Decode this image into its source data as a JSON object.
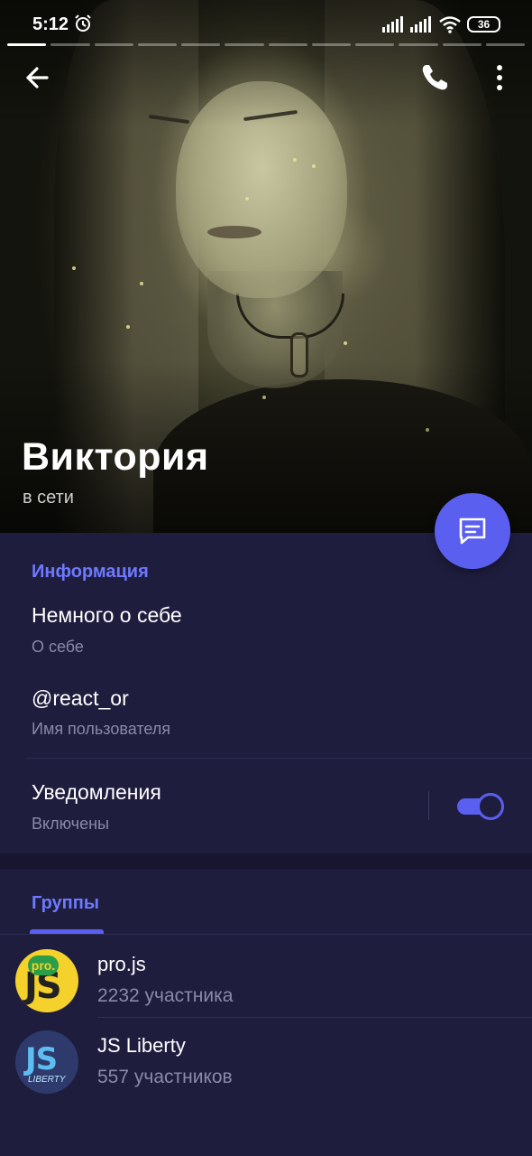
{
  "status_bar": {
    "time": "5:12",
    "battery": "36",
    "icons": [
      "alarm-icon",
      "signal-icon",
      "signal-icon",
      "wifi-icon",
      "battery-icon"
    ]
  },
  "story_progress": {
    "segments": 12,
    "active_index": 0
  },
  "header_actions": {
    "back_icon": "arrow-left-icon",
    "call_icon": "phone-icon",
    "more_icon": "more-vertical-icon"
  },
  "profile": {
    "name": "Виктория",
    "status": "в сети"
  },
  "fab": {
    "icon": "message-icon",
    "color": "#5b5ff0"
  },
  "info": {
    "section_title": "Информация",
    "bio": {
      "value": "Немного о себе",
      "label": "О себе"
    },
    "username": {
      "value": "@react_or",
      "label": "Имя пользователя"
    },
    "notifications": {
      "value": "Уведомления",
      "label": "Включены",
      "enabled": true
    }
  },
  "groups": {
    "tab_label": "Группы",
    "items": [
      {
        "name": "pro.js",
        "members": "2232 участника",
        "avatar_text": "JS",
        "avatar_badge": "pro."
      },
      {
        "name": "JS Liberty",
        "members": "557 участников",
        "avatar_text": "JS",
        "avatar_badge": "LIBERTY"
      }
    ]
  },
  "colors": {
    "accent": "#5b5ff0",
    "section_title": "#6e79ff",
    "background": "#1f1d3e",
    "secondary_text": "#8b89a8"
  }
}
